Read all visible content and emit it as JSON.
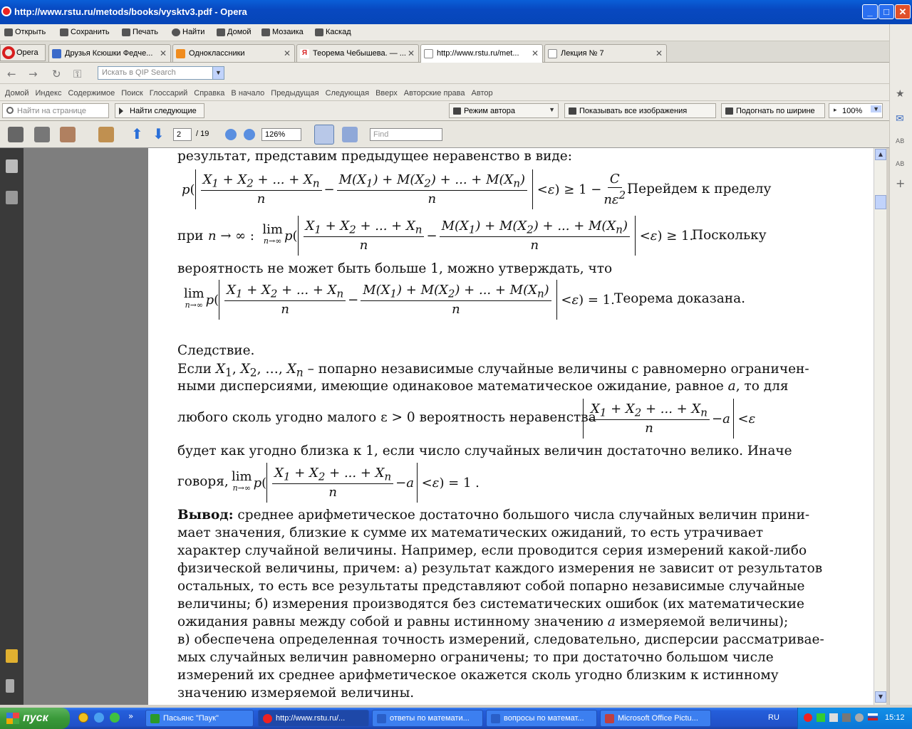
{
  "window": {
    "title": "http://www.rstu.ru/metods/books/vysktv3.pdf - Opera",
    "min": "_",
    "max": "□",
    "close": "✕"
  },
  "menu": [
    "Открыть",
    "Сохранить",
    "Печать",
    "Найти",
    "Домой",
    "Мозаика",
    "Каскад"
  ],
  "opera_button": "Opera",
  "tabs": [
    {
      "label": "Друзья Ксюшки Федче...",
      "color": "#3b6ac9"
    },
    {
      "label": "Одноклассники",
      "color": "#f08c1e"
    },
    {
      "label": "Теорема Чебышева. — ...",
      "color": "#d82222"
    },
    {
      "label": "http://www.rstu.ru/met...",
      "color": "#ffffff"
    },
    {
      "label": "Лекция № 7",
      "color": "#ffffff"
    }
  ],
  "search": {
    "placeholder": "Искать в QIP Search"
  },
  "links": [
    "Домой",
    "Индекс",
    "Содержимое",
    "Поиск",
    "Глоссарий",
    "Справка",
    "В начало",
    "Предыдущая",
    "Следующая",
    "Вверх",
    "Авторские права",
    "Автор"
  ],
  "findbar": {
    "placeholder": "Найти на странице",
    "next": "Найти следующие",
    "mode": "Режим автора",
    "images": "Показывать все изображения",
    "fit": "Подогнать по ширине",
    "zoom": "100%"
  },
  "pdf": {
    "page": "2",
    "of": "/ 19",
    "zoom": "126%",
    "find_placeholder": "Find"
  },
  "doc": {
    "l1": "результат, представим предыдущее неравенство в виде:",
    "l2_after": "Перейдем к пределу",
    "l3_pre": "при",
    "l3_after": "Поскольку",
    "l4": "вероятность не может быть больше 1, можно утверждать, что",
    "l5_after": "Теорема доказана.",
    "l6": "Следствие.",
    "l7_a": "Если",
    "l7_b": "– попарно независимые случайные величины с равномерно ограничен-",
    "l8": "ными дисперсиями, имеющие одинаковое математическое ожидание, равное",
    "l8_b": ", то для",
    "l9": "любого сколь угодно малого ε > 0 вероятность неравенства",
    "l10": "будет как угодно близка к 1, если число случайных величин достаточно велико. Иначе",
    "l11_pre": "говоря,",
    "concl_bold": "Вывод:",
    "concl": [
      " среднее арифметическое достаточно большого числа случайных величин прини-",
      "мает значения, близкие к сумме их математических ожиданий, то есть утрачивает",
      "характер случайной величины. Например, если проводится серия измерений какой-либо",
      "физической величины, причем: а) результат каждого измерения не зависит от результатов",
      "остальных, то есть все результаты представляют собой попарно независимые случайные",
      "величины;  б) измерения производятся без систематических ошибок (их математические",
      "ожидания равны между собой и равны истинному значению",
      "в) обеспечена определенная точность измерений, следовательно, дисперсии рассматривае-",
      "мых случайных величин равномерно ограничены; то при достаточно большом числе",
      "измерений их среднее арифметическое окажется сколь угодно близким к истинному",
      "значению измеряемой величины."
    ],
    "concl_7b": "измеряемой величины);"
  },
  "taskbar": {
    "start": "пуск",
    "items": [
      "Пасьянс \"Паук\"",
      "http://www.rstu.ru/...",
      "ответы по математи...",
      "вопросы по математ...",
      "Microsoft Office Pictu..."
    ],
    "lang": "RU",
    "clock": "15:12"
  }
}
